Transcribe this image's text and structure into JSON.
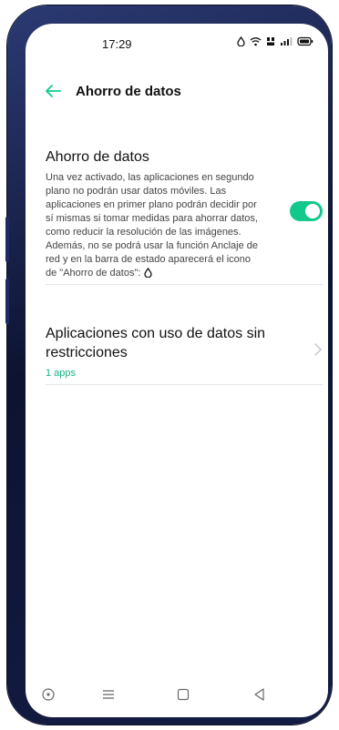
{
  "status_bar": {
    "time": "17:29",
    "icons": [
      "drop-icon",
      "wifi-icon",
      "hd-icon",
      "signal-icon",
      "battery-icon"
    ]
  },
  "app_bar": {
    "title": "Ahorro de datos"
  },
  "data_saver": {
    "heading": "Ahorro de datos",
    "description": "Una vez activado, las aplicaciones en segundo plano no podrán usar datos móviles. Las aplicaciones en primer plano podrán decidir por sí mismas si tomar medidas para ahorrar datos, como reducir la resolución de las imágenes. Además, no se podrá usar la función Anclaje de red y en la barra de estado aparecerá el icono de \"Ahorro de datos\":",
    "toggle_on": true
  },
  "unrestricted_apps": {
    "label": "Aplicaciones con uso de datos sin restricciones",
    "count": "1 apps"
  },
  "colors": {
    "accent": "#12c98b",
    "accent_text": "#12b583",
    "frame": "#131c44"
  }
}
